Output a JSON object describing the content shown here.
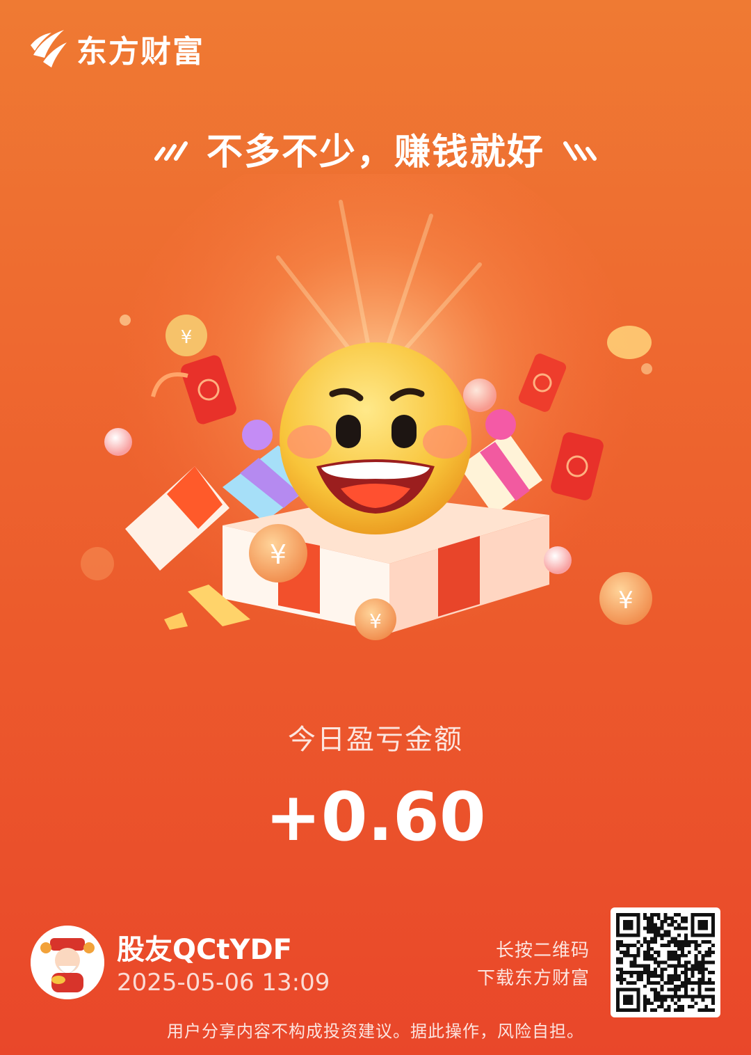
{
  "brand": {
    "name": "东方财富"
  },
  "header": {
    "slogan": "不多不少，赚钱就好"
  },
  "result": {
    "label": "今日盈亏金额",
    "value": "+0.60"
  },
  "user": {
    "name": "股友QCtYDF",
    "timestamp": "2025-05-06 13:09"
  },
  "qr": {
    "hint_line1": "长按二维码",
    "hint_line2": "下载东方财富"
  },
  "footer": {
    "disclaimer": "用户分享内容不构成投资建议。据此操作，风险自担。"
  },
  "colors": {
    "background_top": "#ef7a33",
    "background_bottom": "#e9472a",
    "coin": "#f7b14a"
  }
}
